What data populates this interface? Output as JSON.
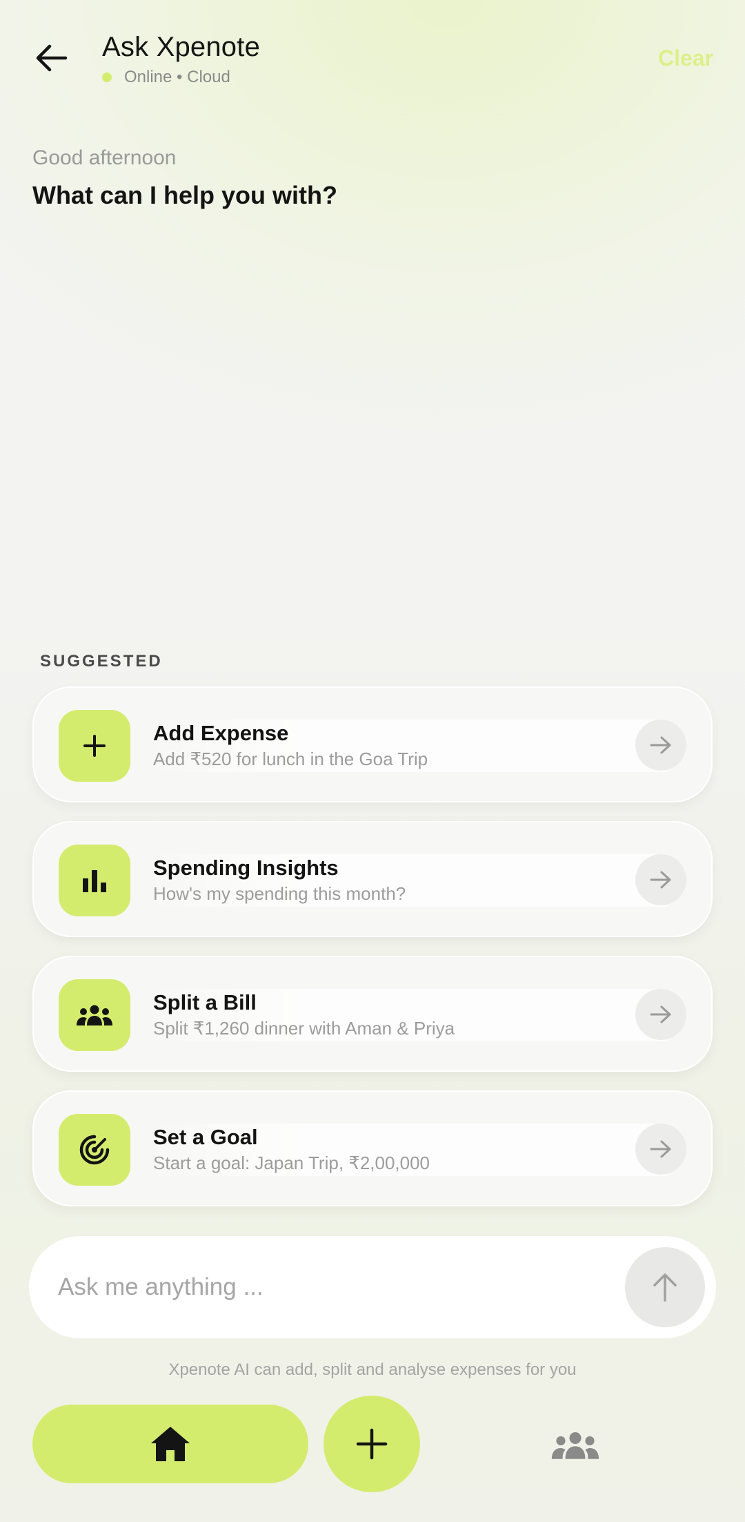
{
  "header": {
    "title": "Ask Xpenote",
    "status": "Online • Cloud",
    "clear_label": "Clear",
    "icons": {
      "back": "arrow-left-icon",
      "status": "online-dot-icon"
    }
  },
  "intro": {
    "greeting": "Good afternoon",
    "prompt": "What can I help you with?"
  },
  "suggested": {
    "label": "SUGGESTED",
    "items": [
      {
        "title": "Add Expense",
        "subtitle": "Add ₹520 for lunch in the Goa Trip",
        "icon": "plus-icon"
      },
      {
        "title": "Spending Insights",
        "subtitle": "How's my spending this month?",
        "icon": "bar-chart-icon"
      },
      {
        "title": "Split a Bill",
        "subtitle": "Split ₹1,260 dinner with Aman & Priya",
        "icon": "group-icon"
      },
      {
        "title": "Set a Goal",
        "subtitle": "Start a goal: Japan Trip, ₹2,00,000",
        "icon": "target-icon"
      }
    ]
  },
  "input": {
    "placeholder": "Ask me anything ...",
    "value": "",
    "send_icon": "arrow-up-icon"
  },
  "disclaimer": "Xpenote AI can add, split and analyse expenses for you",
  "bottom_nav": {
    "icons": [
      "home-icon",
      "plus-icon",
      "group-icon"
    ]
  },
  "colors": {
    "accent": "#d4ec6e",
    "clear": "#dcef8a",
    "text": "#141414",
    "muted": "#9c9c9c",
    "card_bg": "#f7f7f5"
  }
}
